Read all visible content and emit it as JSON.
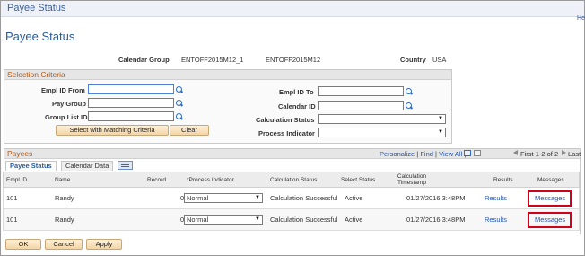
{
  "window": {
    "title": "Payee Status",
    "help_link": "He"
  },
  "page": {
    "title": "Payee Status"
  },
  "info": {
    "calendar_group_label": "Calendar Group",
    "calendar_group_value": "ENTOFF2015M12_1",
    "calendar_group_desc": "ENTOFF2015M12",
    "country_label": "Country",
    "country_value": "USA"
  },
  "selection": {
    "title": "Selection Criteria",
    "empl_id_from_label": "Empl ID From",
    "pay_group_label": "Pay Group",
    "group_list_id_label": "Group List ID",
    "empl_id_to_label": "Empl ID To",
    "calendar_id_label": "Calendar ID",
    "calculation_status_label": "Calculation Status",
    "process_indicator_label": "Process Indicator",
    "select_button": "Select with Matching Criteria",
    "clear_button": "Clear"
  },
  "payees": {
    "title": "Payees",
    "toolbar": {
      "personalize": "Personalize",
      "sep1": "|",
      "find": "Find",
      "sep2": "|",
      "view_all": "View All",
      "sep3": "|",
      "first": "First",
      "range": "1-2 of 2",
      "last": "Last"
    },
    "tabs": [
      "Payee Status",
      "Calendar Data"
    ],
    "columns": [
      "Empl ID",
      "Name",
      "Record",
      "*Process Indicator",
      "Calculation Status",
      "Select Status",
      "Calculation Timestamp",
      "Results",
      "Messages"
    ],
    "rows": [
      {
        "empl_id": "101",
        "name": "Randy",
        "record": "0",
        "process_indicator": "Normal",
        "calc_status": "Calculation Successful",
        "select_status": "Active",
        "timestamp": "01/27/2016  3:48PM",
        "results": "Results",
        "messages": "Messages"
      },
      {
        "empl_id": "101",
        "name": "Randy",
        "record": "0",
        "process_indicator": "Normal",
        "calc_status": "Calculation Successful",
        "select_status": "Active",
        "timestamp": "01/27/2016  3:48PM",
        "results": "Results",
        "messages": "Messages"
      }
    ]
  },
  "footer": {
    "ok": "OK",
    "cancel": "Cancel",
    "apply": "Apply"
  },
  "colors": {
    "accent": "#2b5a9a",
    "section_title": "#b8570f",
    "highlight": "#d0021b",
    "button": "#f4d5a5"
  }
}
